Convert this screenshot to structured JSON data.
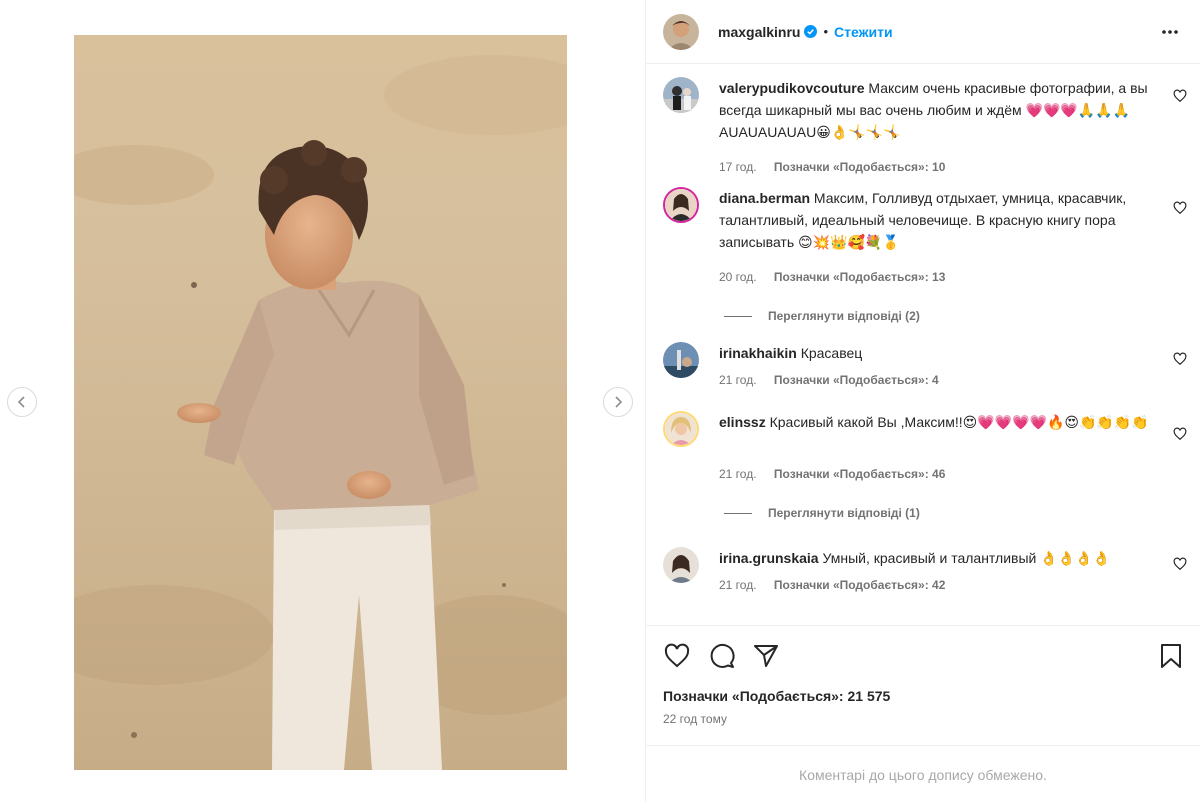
{
  "post": {
    "username": "maxgalkinru",
    "follow_label": "Стежити",
    "separator": "•",
    "likes_text": "Позначки «Подобається»: 21 575",
    "posted_time": "22 год тому",
    "comments_closed": "Коментарі до цього допису обмежено."
  },
  "comments": [
    {
      "user": "valerypudikovcouture",
      "text": "Максим очень красивые фотографии, а вы всегда шикарный мы вас очень любим и ждём 💗💗💗🙏🙏🙏AUAUAUAUAU😀👌🤸🤸🤸",
      "time": "17 год.",
      "likes": "Позначки «Подобається»: 10"
    },
    {
      "user": "diana.berman",
      "text": "Максим, Голливуд отдыхает, умница, красавчик, талантливый, идеальный человечище. В красную книгу пора записывать 😊💥👑🥰💐🥇",
      "time": "20 год.",
      "likes": "Позначки «Подобається»: 13",
      "replies": "Переглянути відповіді (2)"
    },
    {
      "user": "irinakhaikin",
      "text": "Красавец",
      "time": "21 год.",
      "likes": "Позначки «Подобається»: 4"
    },
    {
      "user": "elinssz",
      "text": "Красивый какой Вы ,Максим!!😍💗💗💗💗🔥😍👏👏👏👏",
      "time": "21 год.",
      "likes": "Позначки «Подобається»: 46",
      "replies": "Переглянути відповіді (1)"
    },
    {
      "user": "irina.grunskaia",
      "text": "Умный, красивый и талантливый 👌👌👌👌",
      "time": "21 год.",
      "likes": "Позначки «Подобається»: 42"
    }
  ],
  "icons": {
    "verified": "verified-badge-icon",
    "more": "more-options-icon",
    "like": "heart-icon",
    "comment": "comment-icon",
    "share": "share-icon",
    "save": "bookmark-icon",
    "prev": "chevron-left-icon",
    "next": "chevron-right-icon"
  },
  "colors": {
    "accent": "#0095f6",
    "text": "#262626",
    "muted": "#737373",
    "closed_text": "#a8a8a8"
  }
}
